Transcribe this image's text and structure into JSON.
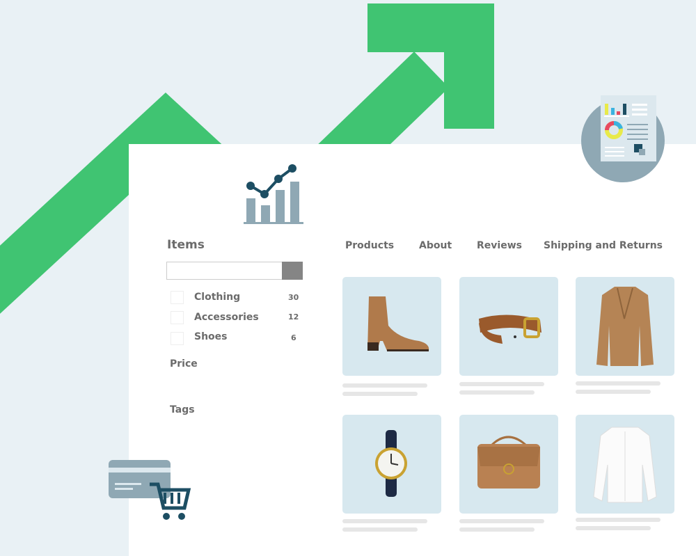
{
  "colors": {
    "background": "#e9f1f5",
    "arrow": "#40c472",
    "panel": "#ffffff",
    "card": "#d7e8ef",
    "icon": "#8fa8b4",
    "icon_dark": "#1d4e63"
  },
  "sidebar": {
    "title": "Items",
    "search": {
      "value": "",
      "placeholder": ""
    },
    "categories": [
      {
        "label": "Clothing",
        "count": "30"
      },
      {
        "label": "Accessories",
        "count": "12"
      },
      {
        "label": "Shoes",
        "count": "6"
      }
    ],
    "price_label": "Price",
    "tags_label": "Tags"
  },
  "nav": [
    {
      "label": "Products"
    },
    {
      "label": "About"
    },
    {
      "label": "Reviews"
    },
    {
      "label": "Shipping and Returns"
    }
  ],
  "products": [
    {
      "icon": "ankle-boot"
    },
    {
      "icon": "belt"
    },
    {
      "icon": "coat"
    },
    {
      "icon": "wristwatch"
    },
    {
      "icon": "handbag"
    },
    {
      "icon": "blouse"
    }
  ],
  "decor": {
    "icons": [
      "trend-arrow",
      "analytics-chart",
      "report-document",
      "credit-card",
      "shopping-cart"
    ]
  }
}
